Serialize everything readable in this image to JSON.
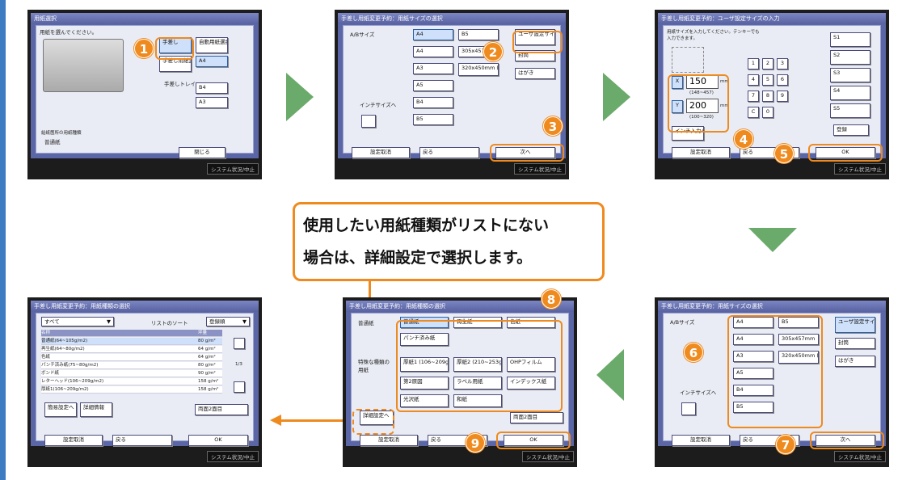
{
  "common": {
    "status": "システム状況/中止"
  },
  "s1": {
    "title": "用紙選択",
    "prompt": "用紙を選んでください。",
    "manual": "手差し",
    "auto": "自動用紙選択",
    "reserve": "手差し用紙変更予約",
    "tray": "手差しトレイ",
    "a4": "A4",
    "b4": "B4",
    "a3": "A3",
    "type_head": "給紙箇所の用紙種類",
    "type": "普通紙",
    "close": "閉じる"
  },
  "s2": {
    "title": "手差し用紙変更予約：用紙サイズの選択",
    "series": "A/Bサイズ",
    "sizes": [
      "A4",
      "B5",
      "A4",
      "305x457mm",
      "A3",
      "320x450mm (SRA3)",
      "A5",
      "B4",
      "B5"
    ],
    "custom": "ユーザ設定サイズ",
    "envelope": "封筒",
    "postcard": "はがき",
    "inch": "インチサイズへ",
    "cancel": "設定取消",
    "back": "戻る",
    "next": "次へ"
  },
  "s3": {
    "title": "手差し用紙変更予約：ユーザ設定サイズの入力",
    "prompt": "用紙サイズを入力してください。テンキーでも入力できます。",
    "x": "X",
    "xval": "150",
    "xunit": "mm",
    "xrange": "(148~457)",
    "y": "Y",
    "yval": "200",
    "yunit": "mm",
    "yrange": "(100~320)",
    "keys": [
      "1",
      "2",
      "3",
      "4",
      "5",
      "6",
      "7",
      "8",
      "9",
      "C",
      "0"
    ],
    "slots": [
      "S1",
      "S2",
      "S3",
      "S4",
      "S5"
    ],
    "reg": "登録",
    "inch": "インチ入力へ",
    "cancel": "設定取消",
    "back": "戻る",
    "ok": "OK"
  },
  "callout": {
    "line1": "使用したい用紙種類がリストにない",
    "line2": "場合は、詳細設定で選択します。"
  },
  "s4": {
    "title": "手差し用紙変更予約：用紙種類の選択",
    "filter": "すべて",
    "sort": "リストのソート",
    "order": "登録順",
    "col1": "名称",
    "col2": "坪量",
    "rows": [
      [
        "普通紙(64~105g/m2)",
        "80 g/m²"
      ],
      [
        "再生紙(64~80g/m2)",
        "64 g/m²"
      ],
      [
        "色紙",
        "64 g/m²"
      ],
      [
        "パンチ済み紙(75~80g/m2)",
        "80 g/m²"
      ],
      [
        "ボンド紙",
        "90 g/m²"
      ],
      [
        "レターヘッド(106~209g/m2)",
        "158 g/m²"
      ],
      [
        "厚紙1(106~209g/m2)",
        "158 g/m²"
      ]
    ],
    "page": "1/3",
    "simple": "簡易設定へ",
    "detail": "詳細情報",
    "duplex": "両面2面目",
    "cancel": "設定取消",
    "back": "戻る",
    "ok": "OK"
  },
  "s5": {
    "title": "手差し用紙変更予約：用紙種類の選択",
    "normal": "普通紙",
    "special": "特殊な種類の用紙",
    "types": [
      "普通紙",
      "再生紙",
      "色紙",
      "パンチ済み紙",
      "厚紙1 (106~209g/m²)",
      "厚紙2 (210~253g/m²)",
      "OHPフィルム",
      "第2原図",
      "ラベル用紙",
      "インデックス紙",
      "光沢紙",
      "和紙"
    ],
    "detail": "詳細設定へ",
    "duplex": "両面2面目",
    "cancel": "設定取消",
    "back": "戻る",
    "ok": "OK"
  },
  "s6": {
    "title": "手差し用紙変更予約：用紙サイズの選択",
    "series": "A/Bサイズ",
    "sizes": [
      "A4",
      "B5",
      "A4",
      "305x457mm",
      "A3",
      "320x450mm (SRA3)",
      "A5",
      "B4",
      "B5"
    ],
    "custom": "ユーザ設定サイズ",
    "envelope": "封筒",
    "postcard": "はがき",
    "inch": "インチサイズへ",
    "cancel": "設定取消",
    "back": "戻る",
    "next": "次へ"
  },
  "steps": [
    "1",
    "2",
    "3",
    "4",
    "5",
    "6",
    "7",
    "8",
    "9"
  ],
  "colors": {
    "accent": "#ef8a1e",
    "arrow": "#6aaa6a",
    "panel": "#5b66a7"
  }
}
